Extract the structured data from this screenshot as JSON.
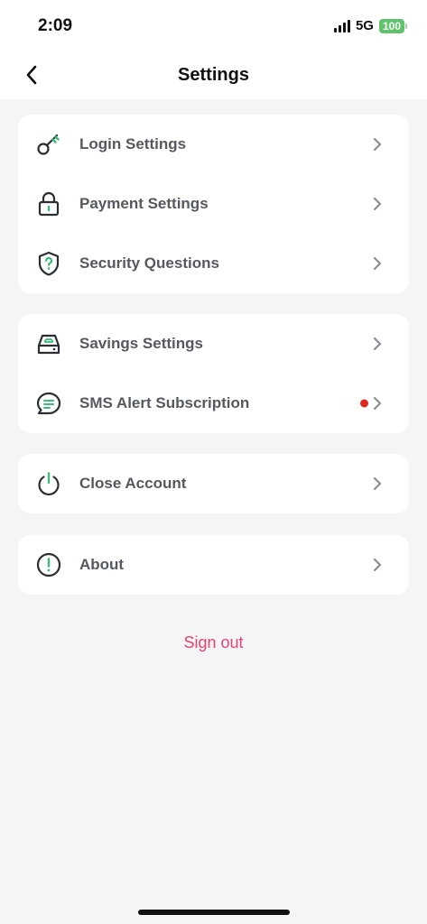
{
  "status_bar": {
    "time": "2:09",
    "network": "5G",
    "battery": "100"
  },
  "header": {
    "title": "Settings",
    "back_icon": "chevron-left-icon"
  },
  "groups": [
    {
      "items": [
        {
          "label": "Login Settings",
          "icon": "key-icon"
        },
        {
          "label": "Payment Settings",
          "icon": "lock-icon"
        },
        {
          "label": "Security Questions",
          "icon": "shield-question-icon"
        }
      ]
    },
    {
      "items": [
        {
          "label": "Savings Settings",
          "icon": "savings-icon"
        },
        {
          "label": "SMS Alert Subscription",
          "icon": "message-icon",
          "badge": "red-dot"
        }
      ]
    },
    {
      "items": [
        {
          "label": "Close Account",
          "icon": "power-icon"
        }
      ]
    },
    {
      "items": [
        {
          "label": "About",
          "icon": "info-icon"
        }
      ]
    }
  ],
  "sign_out": "Sign out",
  "colors": {
    "accent": "#3dbb7a",
    "sign_out": "#e0456f",
    "notification_dot": "#e0281f",
    "label": "#55595f",
    "chevron": "#8a8f96",
    "battery": "#5fc36b"
  }
}
